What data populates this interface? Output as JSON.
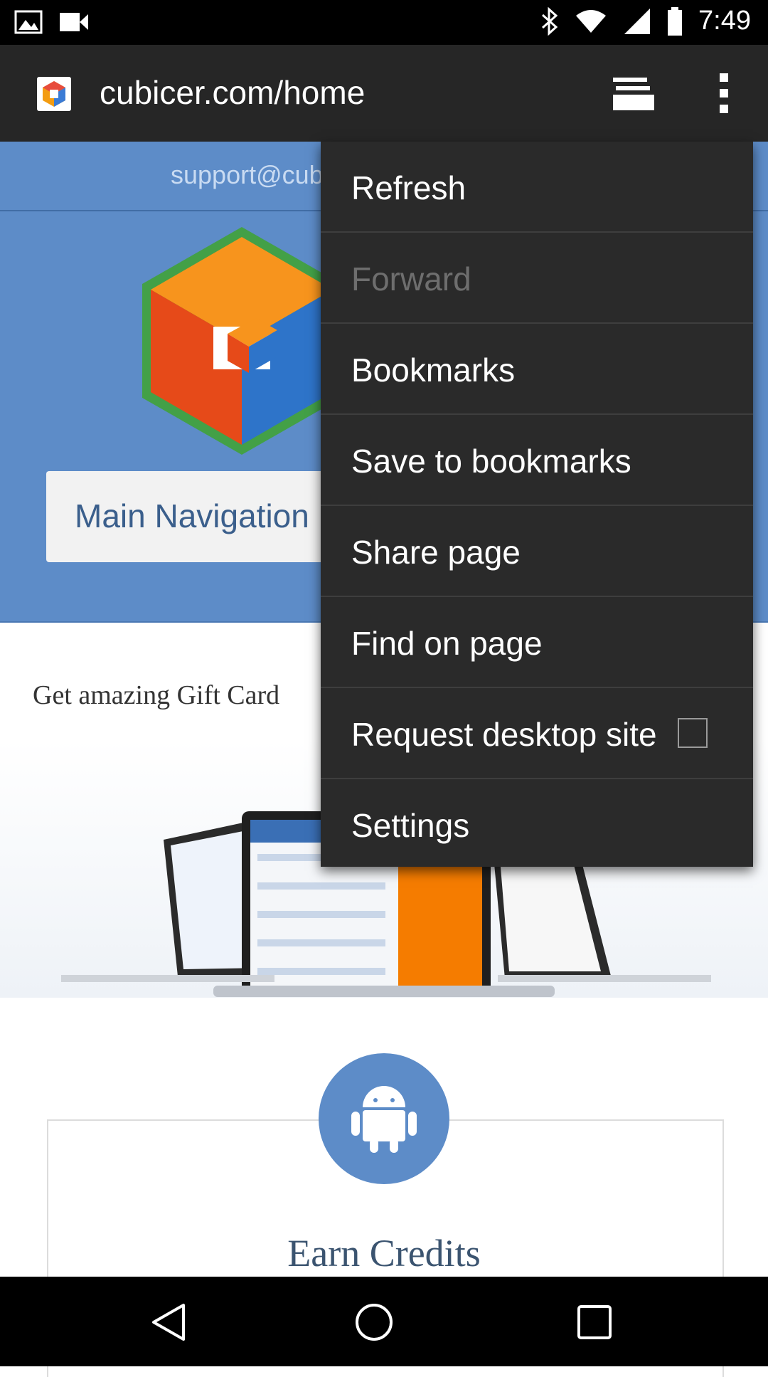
{
  "status_bar": {
    "time": "7:49"
  },
  "browser": {
    "url": "cubicer.com/home"
  },
  "page": {
    "support_text": "support@cub",
    "nav_button_label": "Main Navigation",
    "promo_text": "Get amazing Gift Card",
    "card_title": "Earn Credits"
  },
  "menu": {
    "items": [
      {
        "label": "Refresh",
        "enabled": true
      },
      {
        "label": "Forward",
        "enabled": false
      },
      {
        "label": "Bookmarks",
        "enabled": true
      },
      {
        "label": "Save to bookmarks",
        "enabled": true
      },
      {
        "label": "Share page",
        "enabled": true
      },
      {
        "label": "Find on page",
        "enabled": true
      },
      {
        "label": "Request desktop site",
        "enabled": true,
        "checked": false
      },
      {
        "label": "Settings",
        "enabled": true
      }
    ]
  },
  "colors": {
    "toolbar": "#262626",
    "menu_background": "#2a2a2a",
    "page_accent": "#5d8cc8"
  },
  "icons": [
    "photo-icon",
    "video-icon",
    "bluetooth-icon",
    "wifi-icon",
    "signal-icon",
    "battery-icon",
    "tabs-icon",
    "more-vert-icon",
    "android-icon",
    "back-icon",
    "home-icon",
    "recent-apps-icon"
  ]
}
